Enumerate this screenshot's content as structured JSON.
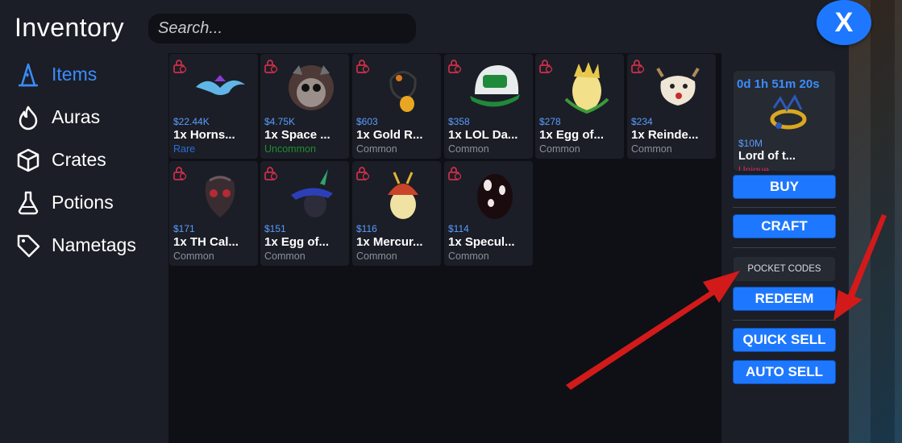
{
  "window": {
    "title": "Inventory",
    "close_label": "X"
  },
  "search": {
    "placeholder": "Search..."
  },
  "sidebar": {
    "items": [
      {
        "label": "Items",
        "icon": "wizard-hat-icon",
        "active": true
      },
      {
        "label": "Auras",
        "icon": "flame-icon",
        "active": false
      },
      {
        "label": "Crates",
        "icon": "crate-box-icon",
        "active": false
      },
      {
        "label": "Potions",
        "icon": "potion-flask-icon",
        "active": false
      },
      {
        "label": "Nametags",
        "icon": "tag-icon",
        "active": false
      }
    ]
  },
  "inventory": {
    "items": [
      {
        "price": "$22.44K",
        "name": "1x  Horns...",
        "rarity": "Rare",
        "rarity_color": "#2a6fd6",
        "thumb": "horns"
      },
      {
        "price": "$4.75K",
        "name": "1x Space ...",
        "rarity": "Uncommon",
        "rarity_color": "#1e8f32",
        "thumb": "space-cat"
      },
      {
        "price": "$603",
        "name": "1x Gold R...",
        "rarity": "Common",
        "rarity_color": "#8a8f99",
        "thumb": "gold-ring"
      },
      {
        "price": "$358",
        "name": "1x LOL Da...",
        "rarity": "Common",
        "rarity_color": "#8a8f99",
        "thumb": "lol-cap"
      },
      {
        "price": "$278",
        "name": "1x Egg of...",
        "rarity": "Common",
        "rarity_color": "#8a8f99",
        "thumb": "crown-egg"
      },
      {
        "price": "$234",
        "name": "1x Reinde...",
        "rarity": "Common",
        "rarity_color": "#8a8f99",
        "thumb": "reindeer"
      },
      {
        "price": "$171",
        "name": "1x TH Cal...",
        "rarity": "Common",
        "rarity_color": "#8a8f99",
        "thumb": "dark-mask"
      },
      {
        "price": "$151",
        "name": "1x Egg of...",
        "rarity": "Common",
        "rarity_color": "#8a8f99",
        "thumb": "hat-egg"
      },
      {
        "price": "$116",
        "name": "1x Mercur...",
        "rarity": "Common",
        "rarity_color": "#8a8f99",
        "thumb": "mercury-egg"
      },
      {
        "price": "$114",
        "name": "1x Specul...",
        "rarity": "Common",
        "rarity_color": "#8a8f99",
        "thumb": "dark-egg"
      }
    ]
  },
  "featured": {
    "timer": "0d 1h 51m 20s",
    "price": "$10M",
    "name": "Lord of t...",
    "rarity": "Unique"
  },
  "actions": {
    "buy": "BUY",
    "craft": "CRAFT",
    "pocket_codes": "POCKET CODES",
    "redeem": "REDEEM",
    "quick_sell": "QUICK SELL",
    "auto_sell": "AUTO SELL"
  },
  "colors": {
    "accent": "#1e78ff",
    "active_sidebar": "#3a8dff",
    "price": "#5a9cff",
    "unique": "#d4285a",
    "arrow": "#d21a1a"
  }
}
